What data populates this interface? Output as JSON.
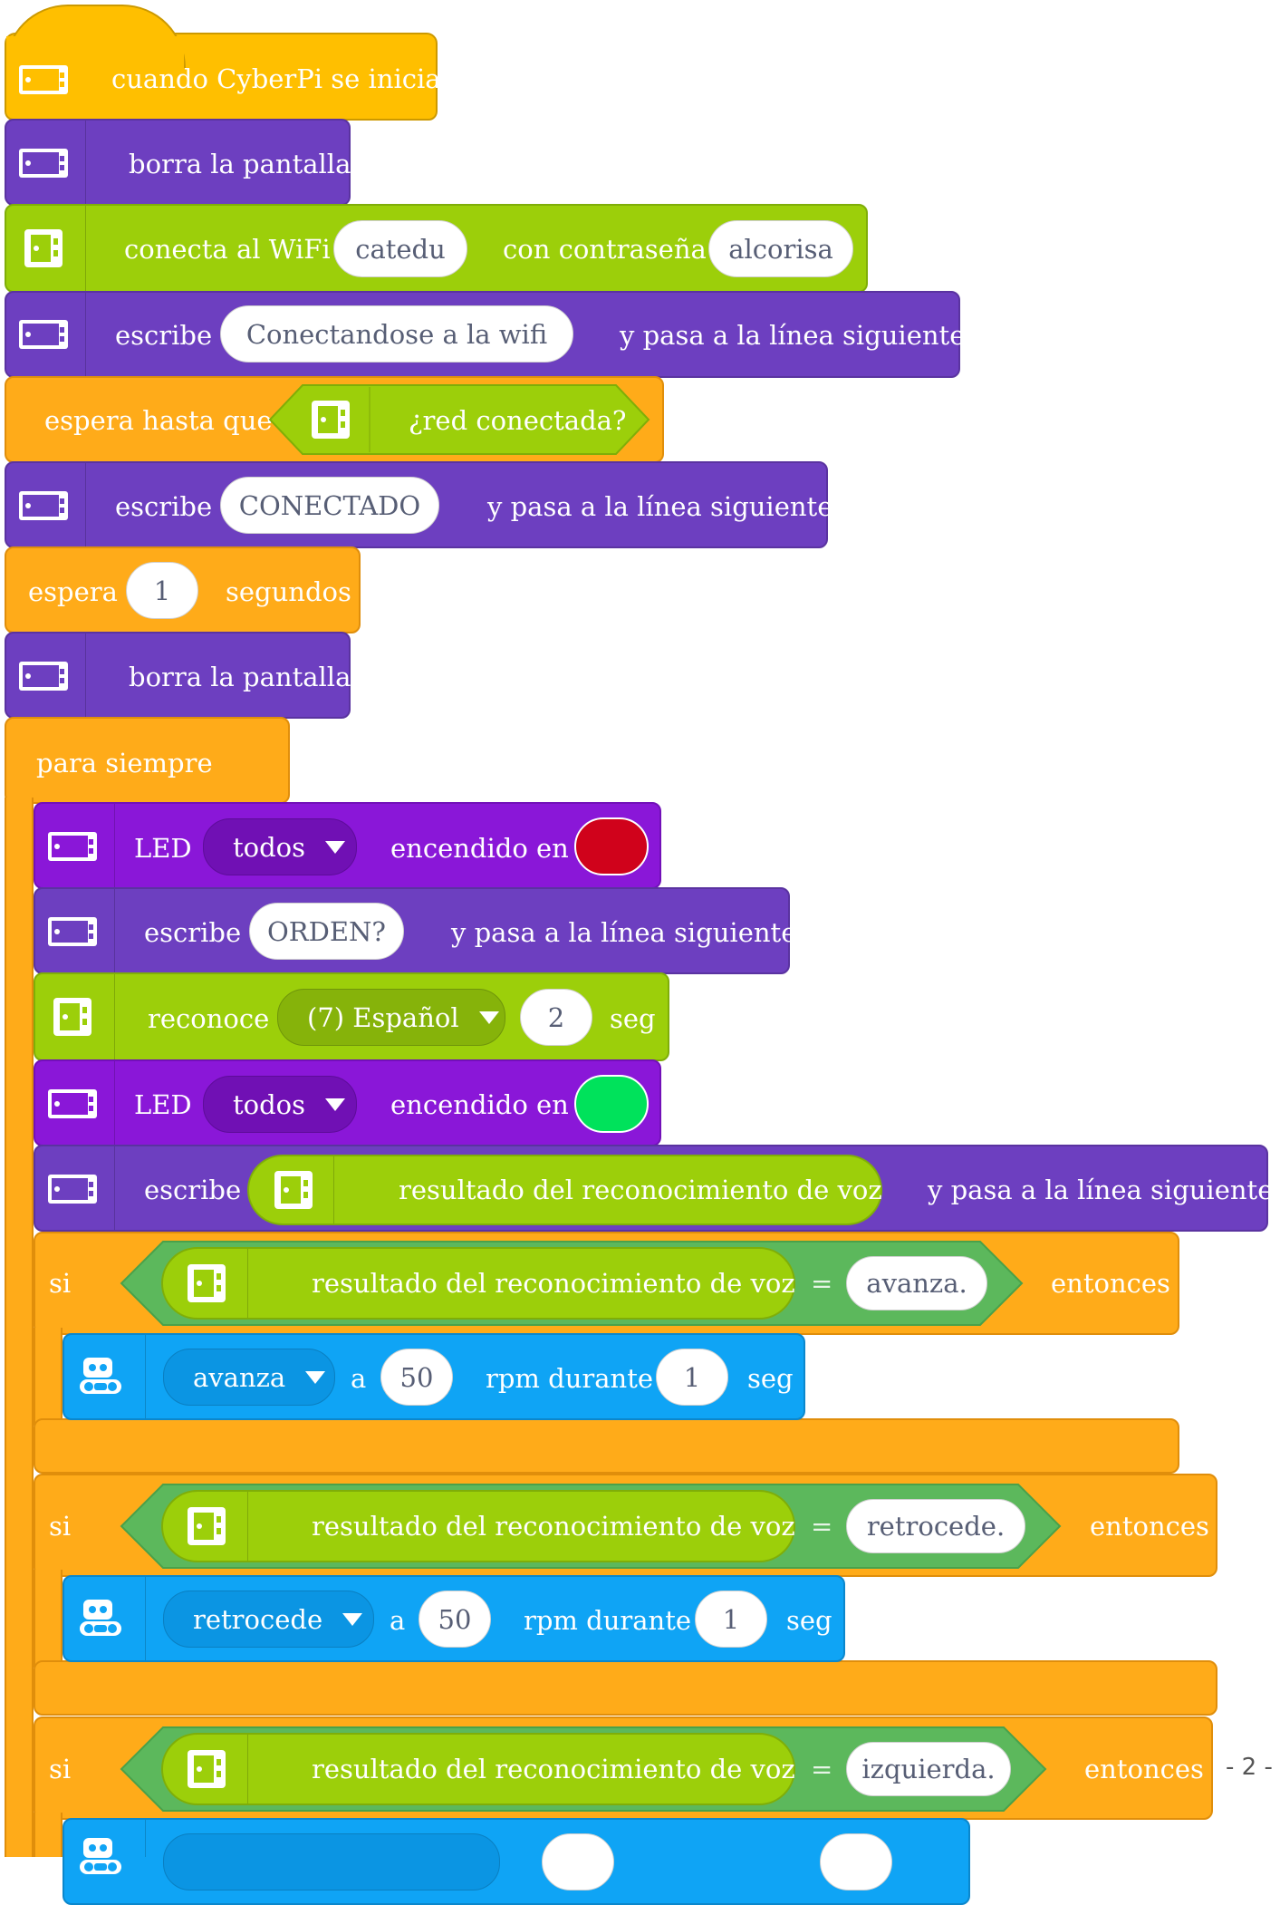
{
  "colors": {
    "event": "#ffbf00",
    "display": "#6d3fc0",
    "wifi": "#9ccf0a",
    "control": "#ffab19",
    "led": "#8a17d8",
    "motion": "#0fa4f5",
    "operator": "#5cb85c",
    "led_red": "#d0021b",
    "led_green": "#00e25b"
  },
  "script": {
    "start": {
      "label": "cuando CyberPi se inicia",
      "icon": "cyberpi-icon"
    },
    "clear1": {
      "label": "borra la pantalla",
      "icon": "cyberpi-icon"
    },
    "wifi": {
      "label": "conecta al WiFi",
      "ssid": "catedu",
      "label2": "con contraseña",
      "password": "alcorisa",
      "icon": "cyberpi-icon"
    },
    "print1": {
      "label": "escribe",
      "text": "Conectandose a la wifi",
      "suffix": "y pasa a la línea siguiente"
    },
    "wait_until": {
      "label": "espera hasta que",
      "condition": "¿red conectada?"
    },
    "print2": {
      "label": "escribe",
      "text": "CONECTADO",
      "suffix": "y pasa a la línea siguiente"
    },
    "wait": {
      "label": "espera",
      "value": "1",
      "unit": "segundos"
    },
    "clear2": {
      "label": "borra la pantalla"
    },
    "forever": {
      "label": "para siempre"
    },
    "led_red": {
      "label": "LED",
      "target": "todos",
      "label2": "encendido en"
    },
    "print3": {
      "label": "escribe",
      "text": "ORDEN?",
      "suffix": "y pasa a la línea siguiente"
    },
    "recognize": {
      "label": "reconoce",
      "language": "(7) Español",
      "value": "2",
      "unit": "seg"
    },
    "led_green": {
      "label": "LED",
      "target": "todos",
      "label2": "encendido en"
    },
    "print4": {
      "label": "escribe",
      "reporter": "resultado del reconocimiento de voz",
      "suffix": "y pasa a la línea siguiente"
    },
    "if1": {
      "if_label": "si",
      "reporter": "resultado del reconocimiento de voz",
      "eq": "=",
      "value": "avanza.",
      "then": "entonces",
      "move": {
        "direction": "avanza",
        "a": "a",
        "speed": "50",
        "unit": "rpm durante",
        "time": "1",
        "seg": "seg"
      }
    },
    "if2": {
      "if_label": "si",
      "reporter": "resultado del reconocimiento de voz",
      "eq": "=",
      "value": "retrocede.",
      "then": "entonces",
      "move": {
        "direction": "retrocede",
        "a": "a",
        "speed": "50",
        "unit": "rpm durante",
        "time": "1",
        "seg": "seg"
      }
    },
    "if3": {
      "if_label": "si",
      "reporter": "resultado del reconocimiento de voz",
      "eq": "=",
      "value": "izquierda.",
      "then": "entonces"
    }
  },
  "page_number": "- 2 -"
}
